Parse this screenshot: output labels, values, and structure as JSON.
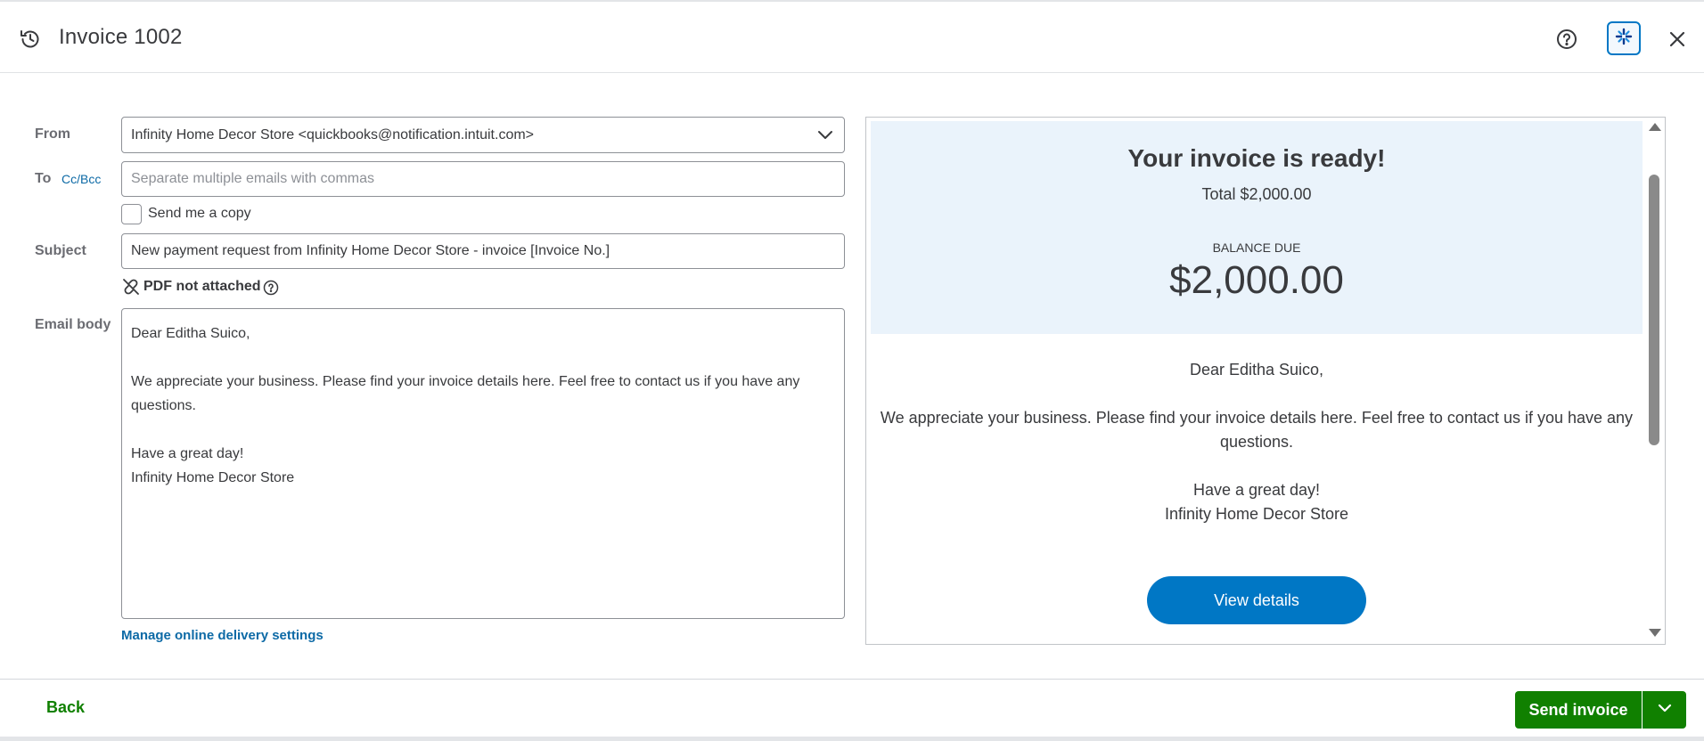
{
  "header": {
    "title": "Invoice 1002",
    "icons": [
      "history-icon",
      "help-icon",
      "ai-assistant-icon",
      "close-icon"
    ],
    "accent_color": "#0077c5"
  },
  "form": {
    "from_label": "From",
    "from_value": "Infinity Home Decor Store <quickbooks@notification.intuit.com>",
    "to_label": "To",
    "cc_bcc_link": "Cc/Bcc",
    "to_placeholder": "Separate multiple emails with commas",
    "send_copy_label": "Send me a copy",
    "send_copy_checked": false,
    "subject_label": "Subject",
    "subject_value": "New payment request from Infinity Home Decor Store - invoice [Invoice No.]",
    "pdf_status": "PDF not attached",
    "email_body_label": "Email body",
    "email_body": {
      "greeting": "Dear Editha Suico,",
      "line1": "We appreciate your business. Please find your invoice details here. Feel free to contact us if you have any",
      "line2": "questions.",
      "closing": "Have a great day!",
      "signature": "Infinity Home Decor Store"
    },
    "manage_link": "Manage online delivery settings"
  },
  "preview": {
    "heading": "Your invoice is ready!",
    "total": "Total $2,000.00",
    "balance_label": "BALANCE DUE",
    "balance_amount": "$2,000.00",
    "greeting": "Dear Editha Suico,",
    "line1": "We appreciate your business. Please find your invoice details here. Feel free to contact us if you have any",
    "line2": "questions.",
    "closing": "Have a great day!",
    "signature": "Infinity Home Decor Store",
    "button": "View details",
    "banner_color": "#eaf3fb"
  },
  "footer": {
    "back_label": "Back",
    "send_label": "Send invoice",
    "primary_color": "#108000"
  }
}
